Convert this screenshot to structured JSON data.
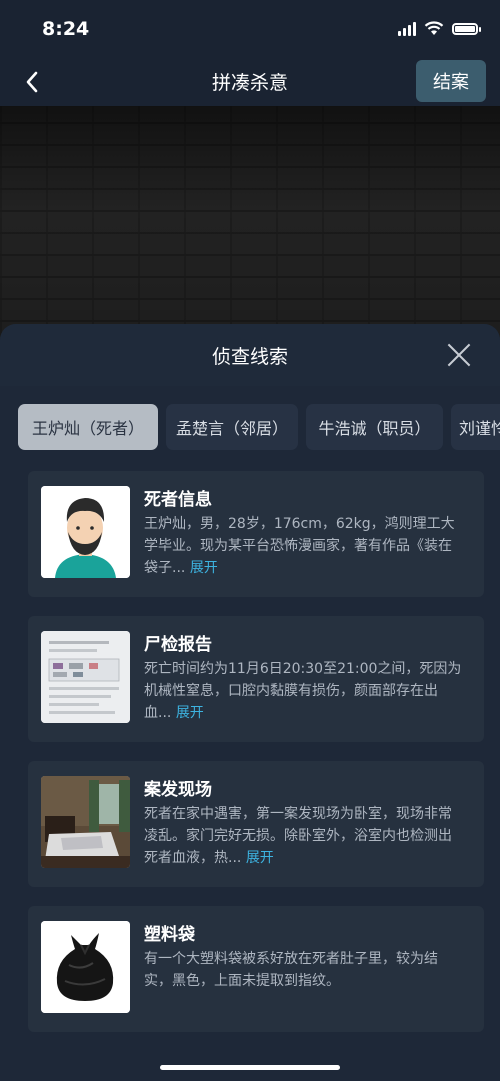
{
  "status": {
    "time": "8:24"
  },
  "nav": {
    "title": "拼凑杀意",
    "action_label": "结案"
  },
  "panel": {
    "title": "侦查线索",
    "tabs": [
      {
        "label": "王炉灿（死者）"
      },
      {
        "label": "孟楚言（邻居）"
      },
      {
        "label": "牛浩诚（职员）"
      },
      {
        "label": "刘谨怜"
      }
    ]
  },
  "clues": [
    {
      "title": "死者信息",
      "text": "王炉灿，男，28岁，176cm，62kg，鸿则理工大学毕业。现为某平台恐怖漫画家，著有作品《装在袋子...",
      "expand": "展开"
    },
    {
      "title": "尸检报告",
      "text": "死亡时间约为11月6日20:30至21:00之间，死因为机械性窒息，口腔内黏膜有损伤，颜面部存在出血...",
      "expand": "展开"
    },
    {
      "title": "案发现场",
      "text": "死者在家中遇害，第一案发现场为卧室，现场非常凌乱。家门完好无损。除卧室外，浴室内也检测出死者血液，热...",
      "expand": "展开"
    },
    {
      "title": "塑料袋",
      "text": "有一个大塑料袋被系好放在死者肚子里，较为结实，黑色，上面未提取到指纹。",
      "expand": ""
    }
  ]
}
